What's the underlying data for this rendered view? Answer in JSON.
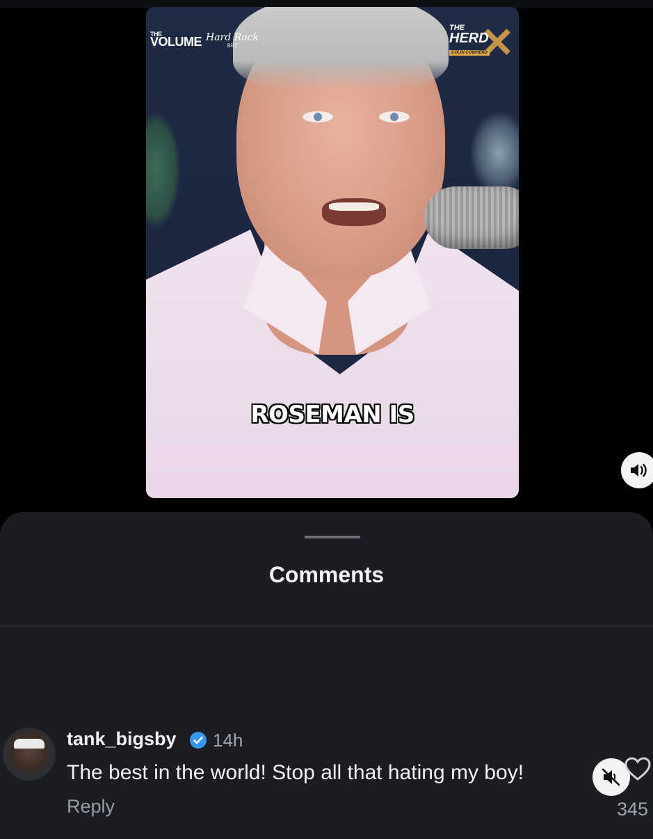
{
  "video": {
    "caption": "ROSEMAN IS",
    "logos": {
      "volume_top": "THE",
      "volume": "VOLUME",
      "hardrock": "Hard Rock",
      "hardrock_sub": "BET",
      "herd_top": "THE",
      "herd": "HERD",
      "herd_sub": "COLIN COWHERD"
    }
  },
  "controls": {
    "volume_icon": "speaker-on-icon",
    "mute_icon": "speaker-muted-icon"
  },
  "comments_sheet": {
    "title": "Comments",
    "comments": [
      {
        "username": "tank_bigsby",
        "verified": true,
        "time": "14h",
        "text": "The best in the world! Stop all that hating my boy!",
        "reply_label": "Reply",
        "likes": "345"
      }
    ]
  },
  "colors": {
    "sheet_bg": "#1b1d22",
    "verified_blue": "#3897f0"
  }
}
